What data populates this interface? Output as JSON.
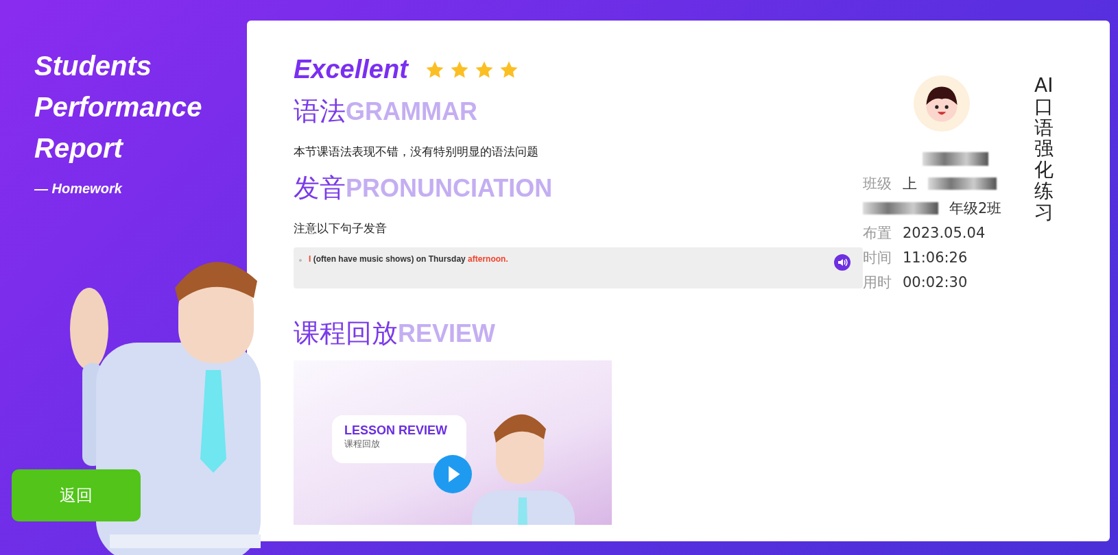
{
  "sidebar": {
    "title_lines": [
      "Students",
      "Performance",
      "Report"
    ],
    "subtitle": "— Homework",
    "back_button": "返回"
  },
  "report": {
    "rating": "Excellent",
    "stars": 4,
    "sections": [
      {
        "kind": "text",
        "title": "语法",
        "title_en": "GRAMMAR",
        "body": "本节课语法表现不错，没有特别明显的语法问题"
      },
      {
        "kind": "pronunciation",
        "title": "发音",
        "title_en": "PRONUNCIATION",
        "body": "注意以下句子发音",
        "sentence": [
          {
            "text": "I",
            "highlight": true
          },
          {
            "text": "(often have music shows) on Thursday",
            "highlight": false
          },
          {
            "text": "afternoon.",
            "highlight": true
          }
        ]
      },
      {
        "kind": "video",
        "title": "课程回放",
        "title_en": "REVIEW",
        "video_title": "LESSON REVIEW",
        "video_subtitle": "课程回放"
      }
    ]
  },
  "profile": {
    "info": [
      {
        "label": "班级",
        "value": "上",
        "value_end": "年级2班"
      },
      {
        "label": "布置",
        "value": "2023.05.04"
      },
      {
        "label": "时间",
        "value": "11:06:26"
      },
      {
        "label": "用时",
        "value": "00:02:30"
      }
    ]
  },
  "side_title": "AI口语强化练习"
}
